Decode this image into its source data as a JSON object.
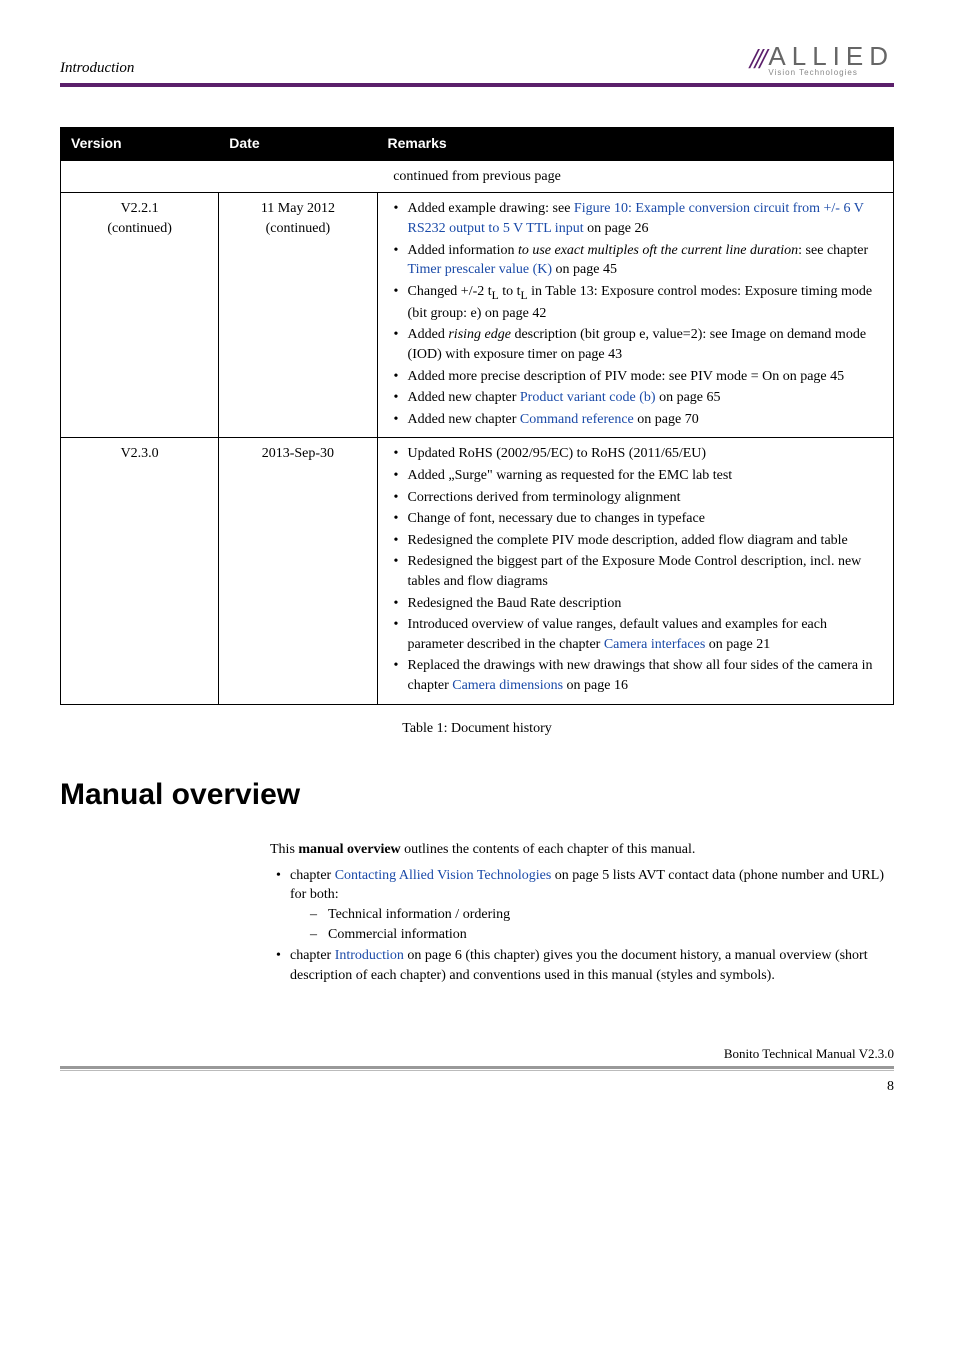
{
  "header": {
    "section": "Introduction",
    "logo_slashes": "///",
    "logo_main": "ALLIED",
    "logo_sub": "Vision Technologies"
  },
  "table": {
    "headers": {
      "version": "Version",
      "date": "Date",
      "remarks": "Remarks"
    },
    "continued": "continued from previous page",
    "rows": [
      {
        "version": "V2.2.1\n(continued)",
        "date": "11 May 2012\n(continued)",
        "remarks": [
          {
            "pre": "Added example drawing: see ",
            "link": "Figure 10: Example conversion circuit from +/- 6 V RS232 output to 5 V TTL input",
            "post": " on page 26"
          },
          {
            "pre": "Added information ",
            "ital": "to use exact multiples oft the current line duration",
            "mid": ": see chapter ",
            "link": "Timer prescaler value (K)",
            "post": " on page 45"
          },
          {
            "text": "Changed +/-2 t_L to t_L in Table 13: Exposure control modes: Exposure timing mode (bit group: e) on page 42"
          },
          {
            "pre": "Added ",
            "ital": "rising edge",
            "post": " description (bit group e, value=2): see Image on demand mode (IOD) with exposure timer on page 43"
          },
          {
            "text": "Added more precise description of PIV mode: see PIV mode = On on page 45"
          },
          {
            "pre": "Added new chapter ",
            "link": "Product variant code (b)",
            "post": " on page 65"
          },
          {
            "pre": "Added new chapter ",
            "link": "Command reference",
            "post": " on page 70"
          }
        ]
      },
      {
        "version": "V2.3.0",
        "date": "2013-Sep-30",
        "remarks": [
          {
            "text": "Updated RoHS (2002/95/EC) to RoHS (2011/65/EU)"
          },
          {
            "text": "Added „Surge\" warning as requested for the EMC lab test"
          },
          {
            "text": "Corrections derived from terminology alignment"
          },
          {
            "text": "Change of font, necessary due to changes in typeface"
          },
          {
            "text": "Redesigned the complete PIV mode description, added flow diagram and table"
          },
          {
            "text": "Redesigned the biggest part of the Exposure Mode Control description, incl. new tables and flow diagrams"
          },
          {
            "text": "Redesigned the Baud Rate description"
          },
          {
            "pre": "Introduced overview of value ranges, default values and examples for each parameter described in the chapter ",
            "link": "Camera interfaces",
            "post": " on page 21"
          },
          {
            "pre": "Replaced the drawings with new drawings that show all four sides of the camera in chapter ",
            "link": "Camera dimensions",
            "post": " on page 16"
          }
        ]
      }
    ],
    "caption": "Table 1: Document history"
  },
  "overview": {
    "heading": "Manual overview",
    "intro_pre": "This ",
    "intro_bold": "manual overview",
    "intro_post": " outlines the contents of each chapter of this manual.",
    "items": [
      {
        "pre": "chapter ",
        "link": "Contacting Allied Vision Technologies",
        "post": " on page 5 lists AVT contact data (phone number and URL) for both:",
        "sub": [
          "Technical information / ordering",
          "Commercial information"
        ]
      },
      {
        "pre": "chapter ",
        "link": "Introduction",
        "post": " on page 6 (this chapter) gives you the document history, a manual overview (short description of each chapter) and conventions used in this manual (styles and symbols)."
      }
    ]
  },
  "footer": {
    "doc": "Bonito Technical Manual V2.3.0",
    "page": "8"
  }
}
